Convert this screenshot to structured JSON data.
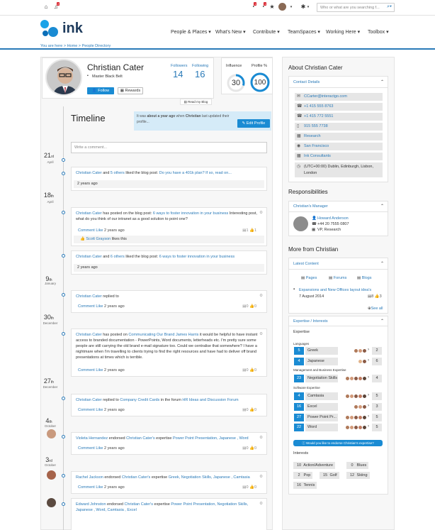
{
  "topbar": {
    "search_placeholder": "Who or what are you searching f...",
    "badge1": "2",
    "badge2": "1",
    "badge3": "1"
  },
  "brand": {
    "name": "ink"
  },
  "nav": [
    {
      "label": "People & Places ▾"
    },
    {
      "label": "What's New ▾"
    },
    {
      "label": "Contribute ▾"
    },
    {
      "label": "TeamSpaces ▾"
    },
    {
      "label": "Working Here ▾"
    },
    {
      "label": "Toolbox ▾"
    }
  ],
  "breadcrumb": {
    "prefix": "You are here >",
    "home": "Home",
    "sep": ">",
    "current": "People Directory"
  },
  "profile": {
    "name": "Christian Cater",
    "belt": "Master Black Belt",
    "followers_label": "Followers",
    "followers": "14",
    "following_label": "Following",
    "following": "16",
    "follow_btn": "Follow",
    "rewards_btn": "Rewards",
    "blog_link": "Read my Blog",
    "influence_label": "Influence",
    "influence": "30",
    "profile_label": "Profile %",
    "profile_pct": "100",
    "profile_fill": 1.0,
    "influence_fill": 0.3
  },
  "timeline": {
    "title": "Timeline",
    "updated_text_1": "It was ",
    "updated_bold": "about a year ago",
    "updated_text_2": " when ",
    "updated_name": "Christian",
    "updated_text_3": " last updated their profile...",
    "edit_btn": "Edit Profile",
    "comment_placeholder": "Write a comment...",
    "dates": [
      {
        "day": "21",
        "suffix": "st",
        "month": "April"
      },
      {
        "day": "18",
        "suffix": "th",
        "month": "April"
      },
      {
        "day": "9",
        "suffix": "th",
        "month": "January"
      },
      {
        "day": "30",
        "suffix": "th",
        "month": "December"
      },
      {
        "day": "27",
        "suffix": "th",
        "month": "December"
      },
      {
        "day": "4",
        "suffix": "th",
        "month": "October"
      },
      {
        "day": "3",
        "suffix": "rd",
        "month": "October"
      }
    ],
    "items": {
      "i1": {
        "a": "Christian Cater",
        "t1": " and ",
        "b": "5 others",
        "t2": " liked the blog post: ",
        "c": "Do you have a 401k plan? If so, read on...",
        "time": "2 years ago"
      },
      "i2": {
        "a": "Christian Cater",
        "t1": " has posted on the blog post: ",
        "b": "6 ways to foster innovation in your business",
        "t2": " Interesting post, what do you think of our intranet as a good solution to point one?",
        "comment": "Comment",
        "like": "Like",
        "time": "2 years ago",
        "n1": "1",
        "n2": "1",
        "liker": "Scott Grayson",
        "liker_text": " likes this"
      },
      "i3": {
        "a": "Christian Cater",
        "t1": " and ",
        "b": "6 others",
        "t2": " liked the blog post: ",
        "c": "6 ways to foster innovation in your business",
        "time": "2 years ago"
      },
      "i4": {
        "a": "Christian Cater",
        "t1": " replied to",
        "comment": "Comment",
        "like": "Like",
        "time": "2 years ago",
        "n1": "0",
        "n2": "0"
      },
      "i5": {
        "a": "Christian Cater",
        "t1": " has posted on ",
        "b": "Communicating Our Brand James Harris",
        "t2": " it would be helpful to have instant access to branded documentation - PowerPoints, Word documents, letterheads etc. I'm pretty sure some people are still carrying the old brand e-mail signature too. Could we centralise that somewhere? I have a nightmare when I'm travelling to clients trying to find the right resources and have had to deliver off brand presentations at times which is terrible.",
        "comment": "Comment",
        "like": "Like",
        "time": "2 years ago",
        "n1": "0",
        "n2": "0"
      },
      "i6": {
        "a": "Christian Cater",
        "t1": " replied to ",
        "b": "Company Credit Cards",
        "t2": " in the forum ",
        "c": "HR Ideas and Discussion Forum",
        "comment": "Comment",
        "like": "Like",
        "time": "2 years ago",
        "n1": "0",
        "n2": "0"
      },
      "i7": {
        "a": "Violeta Hernandez",
        "t1": " endorsed ",
        "b": "Christian Cater's",
        "t2": " expertise ",
        "c": "Power Point Presentation, Japanese , Word",
        "comment": "Comment",
        "like": "Like",
        "time": "2 years ago",
        "n1": "0",
        "n2": "0"
      },
      "i8": {
        "a": "Rachel Jackson",
        "t1": " endorsed ",
        "b": "Christian Cater's",
        "t2": " expertise ",
        "c": "Greek, Negotiation Skills, Japanese , Camtasia",
        "comment": "Comment",
        "like": "Like",
        "time": "2 years ago",
        "n1": "0",
        "n2": "0"
      },
      "i9": {
        "a": "Edward Johnston",
        "t1": " endorsed ",
        "b": "Christian Cater's",
        "t2": " expertise ",
        "c": "Power Point Presentation, Negotiation Skills, Japanese , Word, Camtasia , Excel"
      }
    }
  },
  "about": {
    "title": "About Christian Cater",
    "contact_title": "Contact Details",
    "contacts": [
      {
        "icon": "✉",
        "value": "CCarter@interactgo.com"
      },
      {
        "icon": "☎",
        "value": "+1 415 555 8763"
      },
      {
        "icon": "☎",
        "value": "+1 415 772 5551"
      },
      {
        "icon": "▯",
        "value": "915 555 7738"
      },
      {
        "icon": "▦",
        "value": "Research"
      },
      {
        "icon": "◉",
        "value": "San Francisco"
      },
      {
        "icon": "▦",
        "value": "Ink Consultants"
      },
      {
        "icon": "◷",
        "value": "(UTC+00:00) Dublin, Edinburgh, Lisbon, London"
      }
    ],
    "resp_title": "Responsibilities",
    "manager_title": "Christian's Manager",
    "manager": {
      "name": "Howard Anderson",
      "phone": "+44 20 7555 0807",
      "role": "VP, Research"
    },
    "more_title": "More from Christian",
    "latest_title": "Latest Content",
    "tabs": {
      "pages": "Pages",
      "forums": "Forums",
      "blogs": "Blogs"
    },
    "latest_item": {
      "title": "Expansions and New Offices layout idea's",
      "date": "7 August 2014",
      "n1": "8",
      "n2": "3"
    },
    "see_all": "See all",
    "exp_title": "Expertise / Interests",
    "expertise_label": "Expertise",
    "languages_label": "Languages",
    "mgmt_label": "Management and Business Expertise",
    "software_label": "Software Expertise",
    "skills": {
      "greek": {
        "num": "5",
        "name": "Greek",
        "cnt": "2"
      },
      "japanese": {
        "num": "4",
        "name": "Japanese",
        "cnt": "6"
      },
      "negotiation": {
        "num": "23",
        "name": "Negotiation Skills",
        "cnt": "4"
      },
      "camtasia": {
        "num": "4",
        "name": "Camtasia",
        "cnt": "5"
      },
      "excel": {
        "num": "16",
        "name": "Excel",
        "cnt": "3"
      },
      "powerpoint": {
        "num": "27",
        "name": "Power Point Pr...",
        "cnt": "5"
      },
      "word": {
        "num": "22",
        "name": "Word",
        "cnt": "5"
      }
    },
    "endorse_btn": "Would you like to endorse Christian's expertise?",
    "interests_label": "Interests",
    "interests": {
      "a": {
        "n": "10",
        "name": "Action/Adventure"
      },
      "b": {
        "n": "0",
        "name": "Blues"
      },
      "c": {
        "n": "2",
        "name": "Pop"
      },
      "d": {
        "n": "15",
        "name": "Golf"
      },
      "e": {
        "n": "12",
        "name": "Skiing"
      },
      "f": {
        "n": "16",
        "name": "Tennis"
      }
    }
  }
}
